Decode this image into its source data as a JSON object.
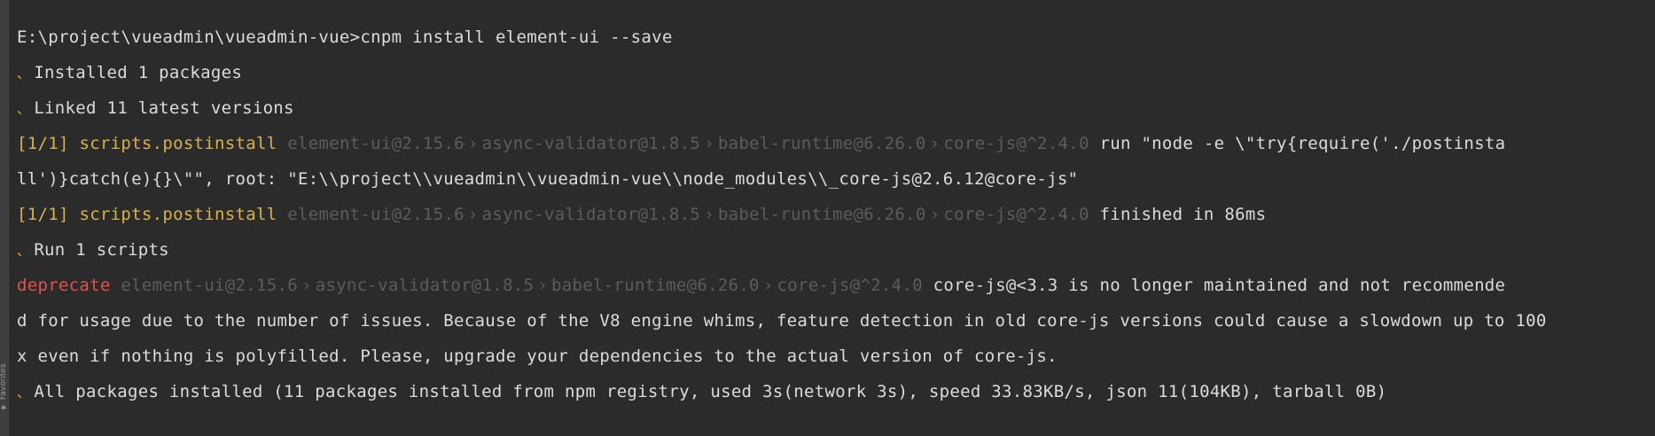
{
  "sidebar": {
    "favorites_label": "Favorites",
    "star_glyph": "★"
  },
  "terminal": {
    "prompt_path": "E:\\project\\vueadmin\\vueadmin-vue>",
    "command": "cnpm install element-ui --save",
    "bullet_glyph": "、",
    "installed_line": "Installed 1 packages",
    "linked_line": "Linked 11 latest versions",
    "postinstall1": {
      "tag": "[1/1]",
      "label": "scripts.postinstall",
      "chain": [
        "element-ui@2.15.6",
        "async-validator@1.8.5",
        "babel-runtime@6.26.0",
        "core-js@^2.4.0"
      ],
      "sep": "›",
      "message_part1": "run \"node -e \\\"try{require('./postinsta",
      "message_part2": "ll')}catch(e){}\\\"\", root: \"E:\\\\project\\\\vueadmin\\\\vueadmin-vue\\\\node_modules\\\\_core-js@2.6.12@core-js\""
    },
    "postinstall2": {
      "tag": "[1/1]",
      "label": "scripts.postinstall",
      "chain": [
        "element-ui@2.15.6",
        "async-validator@1.8.5",
        "babel-runtime@6.26.0",
        "core-js@^2.4.0"
      ],
      "sep": "›",
      "message": "finished in 86ms"
    },
    "run_scripts_line": "Run 1 scripts",
    "deprecate": {
      "label": "deprecate",
      "chain": [
        "element-ui@2.15.6",
        "async-validator@1.8.5",
        "babel-runtime@6.26.0",
        "core-js@^2.4.0"
      ],
      "sep": "›",
      "message_part1": "core-js@<3.3 is no longer maintained and not recommende",
      "message_part2": "d for usage due to the number of issues. Because of the V8 engine whims, feature detection in old core-js versions could cause a slowdown up to 100",
      "message_part3": "x even if nothing is polyfilled. Please, upgrade your dependencies to the actual version of core-js."
    },
    "summary_line": "All packages installed (11 packages installed from npm registry, used 3s(network 3s), speed 33.83KB/s, json 11(104KB), tarball 0B)"
  },
  "colors": {
    "background": "#2b2b2b",
    "text": "#dcdcdc",
    "accent_yellow": "#d6b24a",
    "dim": "#5c5c5c",
    "error_red": "#e0524c"
  }
}
